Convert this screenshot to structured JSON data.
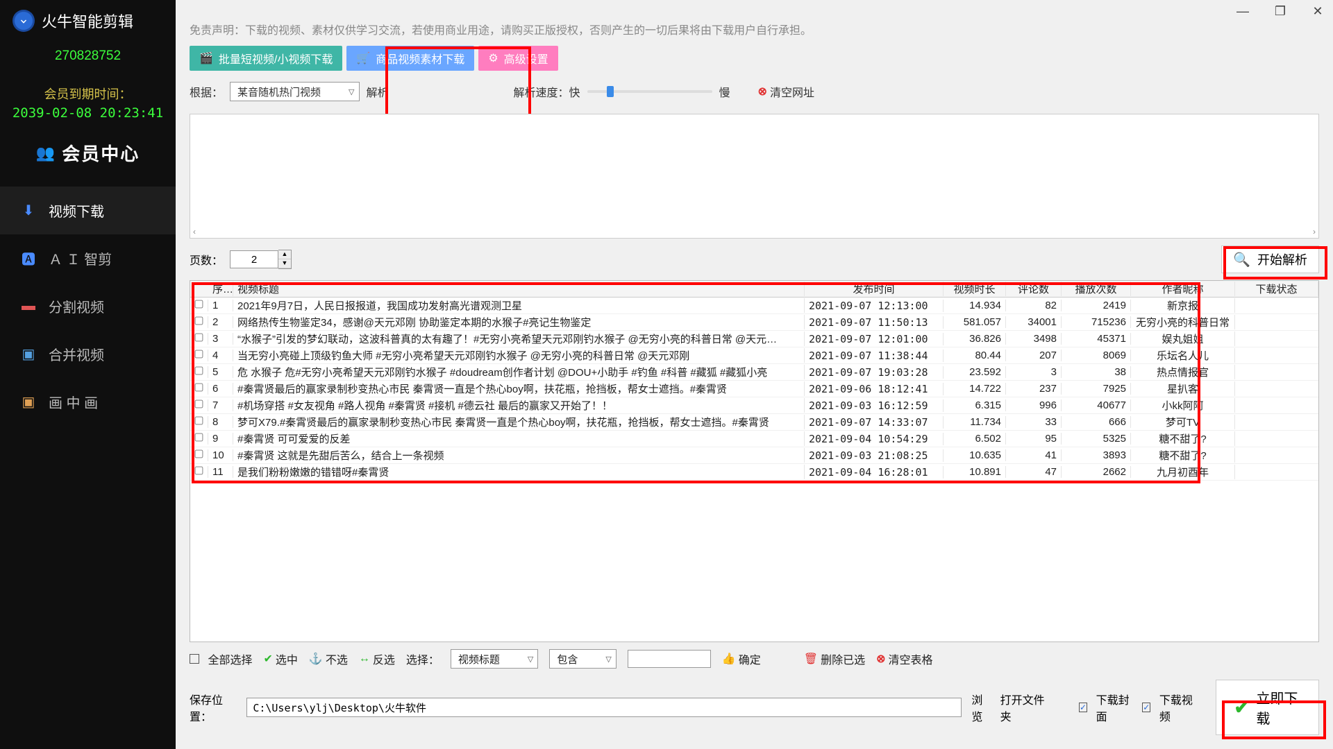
{
  "app": {
    "title": "火牛智能剪辑",
    "id": "270828752",
    "expire_label": "会员到期时间：",
    "expire_value": "2039-02-08 20:23:41",
    "member_center": "会员中心"
  },
  "nav": [
    {
      "label": "视频下载",
      "icon": "⬇"
    },
    {
      "label": "Ａ Ｉ 智剪",
      "icon": "🟦"
    },
    {
      "label": "分割视频",
      "icon": "🟥"
    },
    {
      "label": "合并视频",
      "icon": "🖼"
    },
    {
      "label": "画 中 画",
      "icon": "🖼"
    }
  ],
  "disclaimer": "免责声明：下载的视频、素材仅供学习交流，若使用商业用途，请购买正版授权，否则产生的一切后果将由下载用户自行承担。",
  "tabs": [
    "批量短视频/小视频下载",
    "商品视频素材下载",
    "高级设置"
  ],
  "controls": {
    "basis_label": "根据：",
    "basis_value": "某音随机热门视频",
    "parse": "解析",
    "speed_label": "解析速度：快",
    "speed_slow": "慢",
    "clear_url": "清空网址",
    "pages_label": "页数：",
    "pages_value": "2",
    "start_parse": "开始解析"
  },
  "columns": [
    "序号",
    "视频标题",
    "发布时间",
    "视频时长",
    "评论数",
    "播放次数",
    "作者昵称",
    "下载状态"
  ],
  "rows": [
    {
      "i": "1",
      "t": "2021年9月7日，人民日报报道，我国成功发射高光谱观测卫星",
      "d": "2021-09-07 12:13:00",
      "dur": "14.934",
      "cm": "82",
      "pl": "2419",
      "a": "新京报"
    },
    {
      "i": "2",
      "t": "网络热传生物鉴定34，感谢@天元邓刚 协助鉴定本期的水猴子#亮记生物鉴定",
      "d": "2021-09-07 11:50:13",
      "dur": "581.057",
      "cm": "34001",
      "pl": "715236",
      "a": "无穷小亮的科普日常"
    },
    {
      "i": "3",
      "t": "“水猴子”引发的梦幻联动，这波科普真的太有趣了！#无穷小亮希望天元邓刚钓水猴子  @无穷小亮的科普日常 @天元…",
      "d": "2021-09-07 12:01:00",
      "dur": "36.826",
      "cm": "3498",
      "pl": "45371",
      "a": "娱丸姐姐"
    },
    {
      "i": "4",
      "t": "当无穷小亮碰上顶级钓鱼大师  #无穷小亮希望天元邓刚钓水猴子  @无穷小亮的科普日常 @天元邓刚",
      "d": "2021-09-07 11:38:44",
      "dur": "80.44",
      "cm": "207",
      "pl": "8069",
      "a": "乐坛名人儿"
    },
    {
      "i": "5",
      "t": "危 水猴子 危#无穷小亮希望天元邓刚钓水猴子 #doudream创作者计划 @DOU+小助手 #钓鱼 #科普 #藏狐 #藏狐小亮",
      "d": "2021-09-07 19:03:28",
      "dur": "23.592",
      "cm": "3",
      "pl": "38",
      "a": "热点情报官"
    },
    {
      "i": "6",
      "t": "#秦霄贤最后的赢家录制秒变热心市民  秦霄贤一直是个热心boy啊，扶花瓶，抢挡板，帮女士遮挡。#秦霄贤",
      "d": "2021-09-06 18:12:41",
      "dur": "14.722",
      "cm": "237",
      "pl": "7925",
      "a": "星扒客"
    },
    {
      "i": "7",
      "t": "#机场穿搭 #女友视角 #路人视角 #秦霄贤 #接机 #德云社 最后的赢家又开始了！！",
      "d": "2021-09-03 16:12:59",
      "dur": "6.315",
      "cm": "996",
      "pl": "40677",
      "a": "小kk阿阿"
    },
    {
      "i": "8",
      "t": "梦可X79.#秦霄贤最后的赢家录制秒变热心市民  秦霄贤一直是个热心boy啊，扶花瓶，抢挡板，帮女士遮挡。#秦霄贤",
      "d": "2021-09-07 14:33:07",
      "dur": "11.734",
      "cm": "33",
      "pl": "666",
      "a": "梦可TV"
    },
    {
      "i": "9",
      "t": "#秦霄贤 可可爱爱的反差",
      "d": "2021-09-04 10:54:29",
      "dur": "6.502",
      "cm": "95",
      "pl": "5325",
      "a": "糖不甜了?"
    },
    {
      "i": "10",
      "t": "#秦霄贤 这就是先甜后苦么，结合上一条视频",
      "d": "2021-09-03 21:08:25",
      "dur": "10.635",
      "cm": "41",
      "pl": "3893",
      "a": "糖不甜了?"
    },
    {
      "i": "11",
      "t": "是我们粉粉嫩嫩的错错呀#秦霄贤",
      "d": "2021-09-04 16:28:01",
      "dur": "10.891",
      "cm": "47",
      "pl": "2662",
      "a": "九月初酉年"
    }
  ],
  "bottom": {
    "select_all": "全部选择",
    "check": "选中",
    "uncheck": "不选",
    "invert": "反选",
    "choose": "选择：",
    "field": "视频标题",
    "op": "包含",
    "ok": "确定",
    "del": "删除已选",
    "clear": "清空表格",
    "save_label": "保存位置：",
    "path": "C:\\Users\\ylj\\Desktop\\火牛软件",
    "browse": "浏览",
    "open": "打开文件夹",
    "dl_cover": "下载封面",
    "dl_video": "下载视频",
    "download": "立即下载"
  }
}
